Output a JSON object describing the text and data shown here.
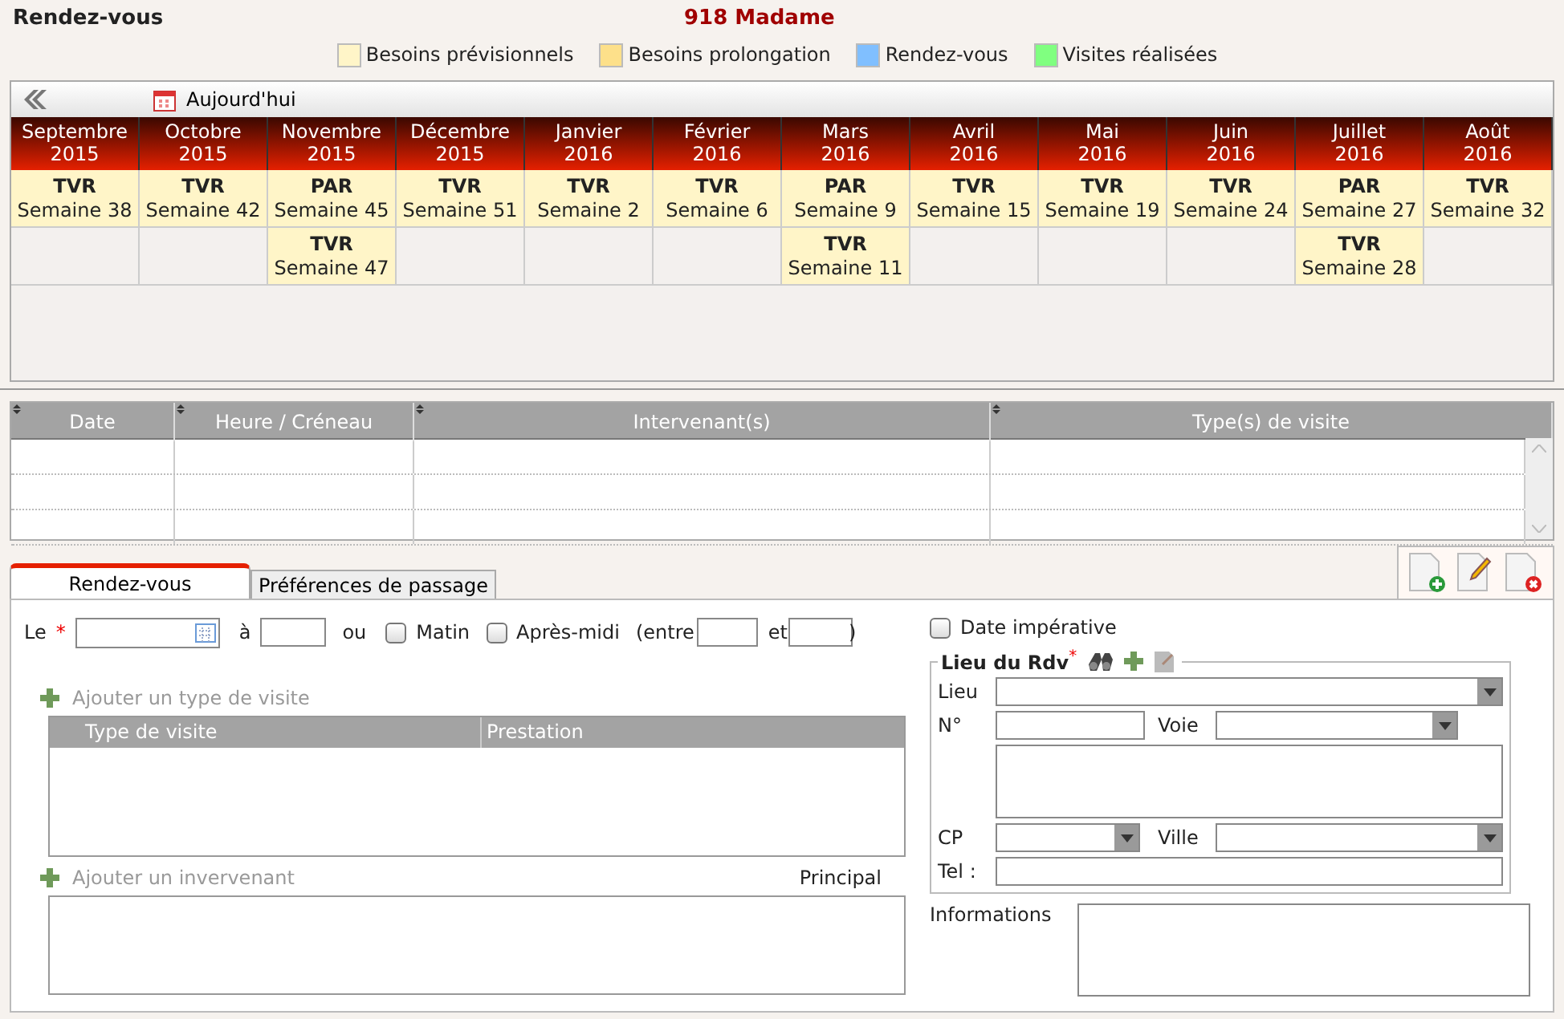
{
  "header": {
    "title": "Rendez-vous",
    "patient": "918 Madame"
  },
  "legend": [
    {
      "label": "Besoins prévisionnels",
      "color": "#fff5c8"
    },
    {
      "label": "Besoins prolongation",
      "color": "#fde08a"
    },
    {
      "label": "Rendez-vous",
      "color": "#80bfff"
    },
    {
      "label": "Visites réalisées",
      "color": "#80ff80"
    }
  ],
  "calendar": {
    "today_button": "Aujourd'hui",
    "months": [
      {
        "month": "Septembre",
        "year": "2015",
        "entries": [
          {
            "code": "TVR",
            "week": "Semaine 38",
            "color": "#fff5c8"
          }
        ]
      },
      {
        "month": "Octobre",
        "year": "2015",
        "entries": [
          {
            "code": "TVR",
            "week": "Semaine 42",
            "color": "#fff5c8"
          }
        ]
      },
      {
        "month": "Novembre",
        "year": "2015",
        "entries": [
          {
            "code": "PAR",
            "week": "Semaine 45",
            "color": "#fff5c8"
          },
          {
            "code": "TVR",
            "week": "Semaine 47",
            "color": "#fff5c8"
          }
        ]
      },
      {
        "month": "Décembre",
        "year": "2015",
        "entries": [
          {
            "code": "TVR",
            "week": "Semaine 51",
            "color": "#fff5c8"
          }
        ]
      },
      {
        "month": "Janvier",
        "year": "2016",
        "entries": [
          {
            "code": "TVR",
            "week": "Semaine 2",
            "color": "#fff5c8"
          }
        ]
      },
      {
        "month": "Février",
        "year": "2016",
        "entries": [
          {
            "code": "TVR",
            "week": "Semaine 6",
            "color": "#fff5c8"
          }
        ]
      },
      {
        "month": "Mars",
        "year": "2016",
        "entries": [
          {
            "code": "PAR",
            "week": "Semaine 9",
            "color": "#fff5c8"
          },
          {
            "code": "TVR",
            "week": "Semaine 11",
            "color": "#fff5c8"
          }
        ]
      },
      {
        "month": "Avril",
        "year": "2016",
        "entries": [
          {
            "code": "TVR",
            "week": "Semaine 15",
            "color": "#fff5c8"
          }
        ]
      },
      {
        "month": "Mai",
        "year": "2016",
        "entries": [
          {
            "code": "TVR",
            "week": "Semaine 19",
            "color": "#fff5c8"
          }
        ]
      },
      {
        "month": "Juin",
        "year": "2016",
        "entries": [
          {
            "code": "TVR",
            "week": "Semaine 24",
            "color": "#fff5c8"
          }
        ]
      },
      {
        "month": "Juillet",
        "year": "2016",
        "entries": [
          {
            "code": "PAR",
            "week": "Semaine 27",
            "color": "#fff5c8"
          },
          {
            "code": "TVR",
            "week": "Semaine 28",
            "color": "#fff5c8"
          }
        ]
      },
      {
        "month": "Août",
        "year": "2016",
        "entries": [
          {
            "code": "TVR",
            "week": "Semaine 32",
            "color": "#fff5c8"
          }
        ]
      }
    ]
  },
  "appointments": {
    "columns": [
      "Date",
      "Heure / Créneau",
      "Intervenant(s)",
      "Type(s) de visite"
    ]
  },
  "tabs": [
    {
      "label": "Rendez-vous",
      "selected": true
    },
    {
      "label": "Préférences de passage",
      "selected": false
    }
  ],
  "form": {
    "date_label": "Le",
    "required_mark": "*",
    "time_label": "à",
    "or_label": "ou",
    "slots": [
      {
        "label": "Matin",
        "checked": false
      },
      {
        "label": "Après-midi",
        "checked": false
      }
    ],
    "between_label": "(entre",
    "and_label": "et",
    "close_paren": ")",
    "add_visit_type": "Ajouter un type de visite",
    "visit_columns": [
      "Type de visite",
      "Prestation"
    ],
    "add_staff": "Ajouter un invervenant",
    "principal_label": "Principal",
    "mandatory_date": {
      "label": "Date impérative",
      "checked": false
    },
    "place": {
      "legend": "Lieu du Rdv",
      "required_mark": "*",
      "place_label": "Lieu",
      "number_label": "N°",
      "street_label": "Voie",
      "zip_label": "CP",
      "city_label": "Ville",
      "phone_label": "Tel :"
    },
    "info_label": "Informations"
  }
}
